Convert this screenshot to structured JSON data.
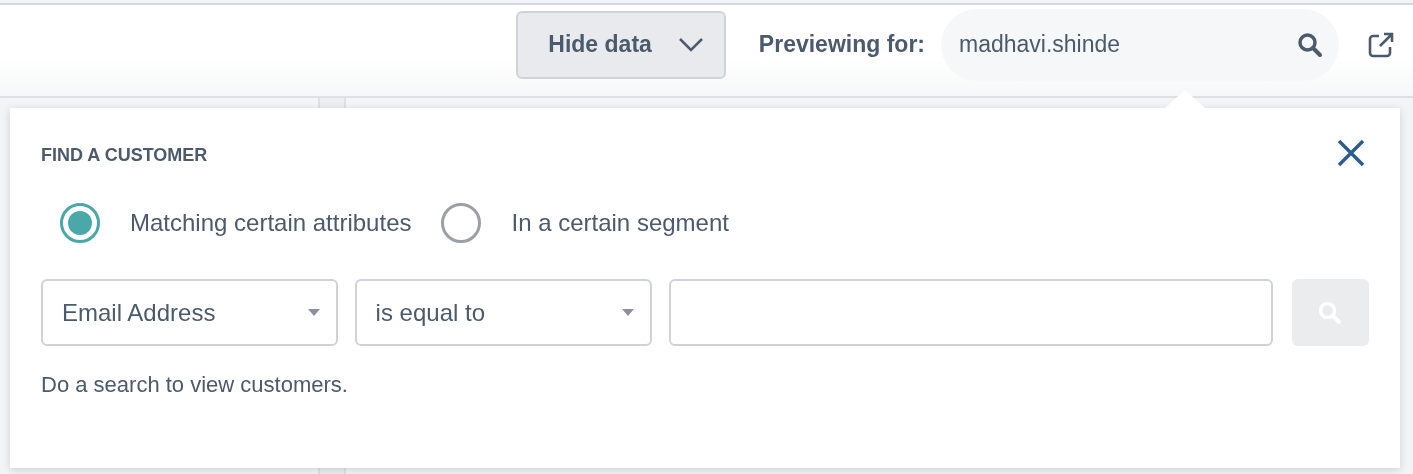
{
  "toolbar": {
    "hide_data_button": "Hide data",
    "previewing_label": "Previewing for:",
    "preview_user": "madhavi.shinde"
  },
  "popover": {
    "title": "FIND A CUSTOMER",
    "search_modes": [
      {
        "label": "Matching certain attributes",
        "selected": true
      },
      {
        "label": "In a certain segment",
        "selected": false
      }
    ],
    "filter": {
      "attribute": "Email Address",
      "operator": "is equal to",
      "search_disabled": true
    },
    "hint": "Do a search to view customers."
  }
}
